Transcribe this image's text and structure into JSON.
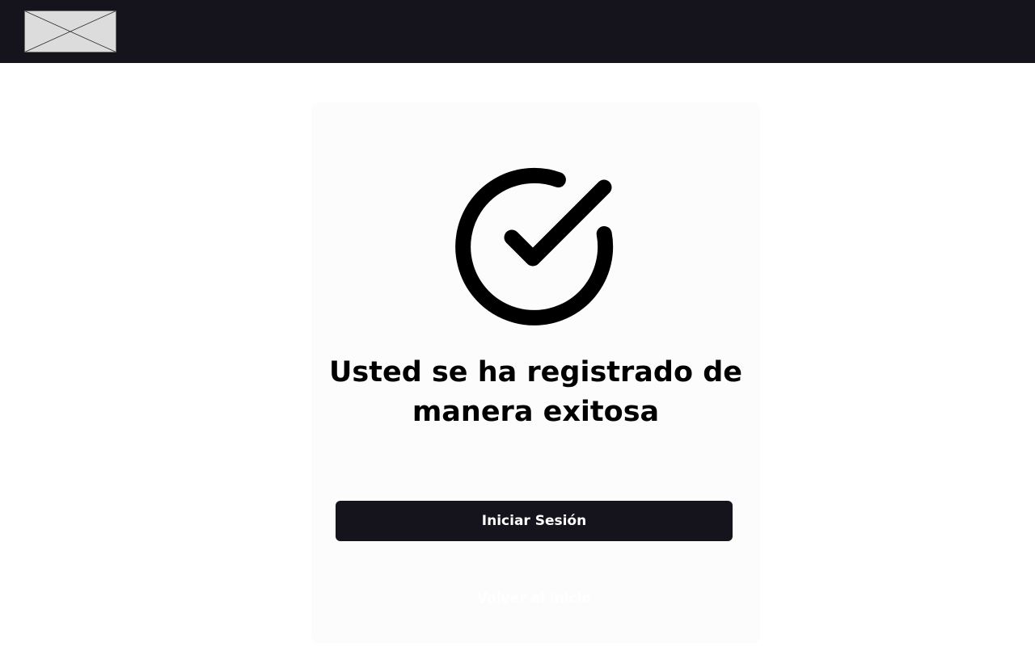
{
  "header": {
    "logo_icon": "image-placeholder-icon",
    "background_color": "#15141c"
  },
  "main": {
    "success_icon": "check-circle-icon",
    "message": "Usted se ha registrado de manera exitosa",
    "primary_button_label": "Iniciar Sesión",
    "secondary_button_label": "Volver al inicio",
    "card_background": "#fcfcfc",
    "button_color": "#15141c"
  }
}
